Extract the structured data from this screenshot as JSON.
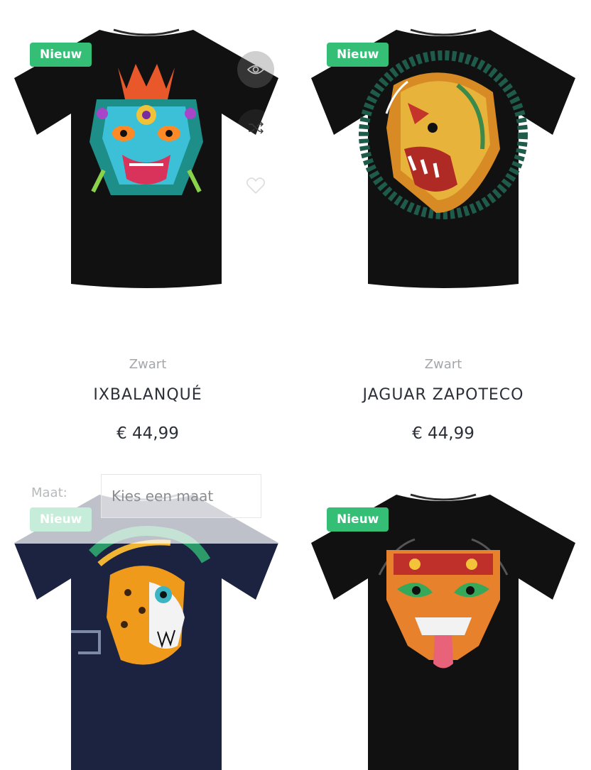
{
  "badge_label": "Nieuw",
  "products": [
    {
      "color": "Zwart",
      "title": "IXBALANQUÉ",
      "price": "€ 44,99"
    },
    {
      "color": "Zwart",
      "title": "JAGUAR ZAPOTECO",
      "price": "€ 44,99"
    },
    {
      "color": "",
      "title": "",
      "price": ""
    },
    {
      "color": "",
      "title": "",
      "price": ""
    }
  ],
  "quick_actions": [
    "eye-icon",
    "shuffle-icon",
    "heart-icon"
  ],
  "size_picker": {
    "label": "Maat:",
    "placeholder": "Kies een maat"
  },
  "colors": {
    "badge": "#35bf76",
    "shirt_black": "#111111",
    "shirt_navy": "#1b2341"
  }
}
